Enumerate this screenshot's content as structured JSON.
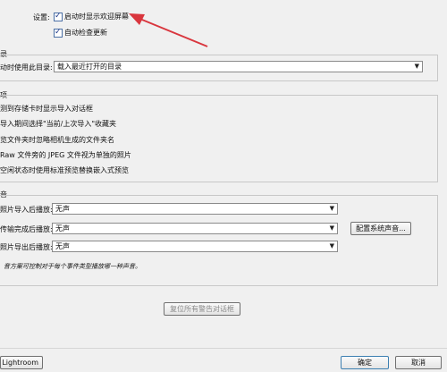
{
  "startup": {
    "label": "设置:",
    "show_welcome": "启动时显示欢迎屏幕",
    "auto_update": "自动检查更新"
  },
  "catalog": {
    "section": "录",
    "label": "动时使用此目录:",
    "value": "载入最近打开的目录"
  },
  "import": {
    "section": "项",
    "options": [
      "测到存储卡时显示导入对话框",
      "导入期间选择\"当前/上次导入\"收藏夹",
      "览文件夹时忽略相机生成的文件夹名",
      "Raw 文件旁的 JPEG 文件视为单独的照片",
      "空闲状态时使用标准预览替换嵌入式预览"
    ]
  },
  "sounds": {
    "section": "音",
    "rows": [
      {
        "label": "照片导入后播放:",
        "value": "无声"
      },
      {
        "label": "传输完成后播放:",
        "value": "无声"
      },
      {
        "label": "照片导出后播放:",
        "value": "无声"
      }
    ],
    "config_button": "配置系统声音...",
    "note": "音方案可控制对于每个事件类型播放哪一种声音。"
  },
  "reset_warnings": "复位所有警告对话框",
  "footer": {
    "lightroom": "Lightroom",
    "ok": "确定",
    "cancel": "取消"
  },
  "colors": {
    "arrow": "#d9363e",
    "background": "#f0f0f0"
  }
}
